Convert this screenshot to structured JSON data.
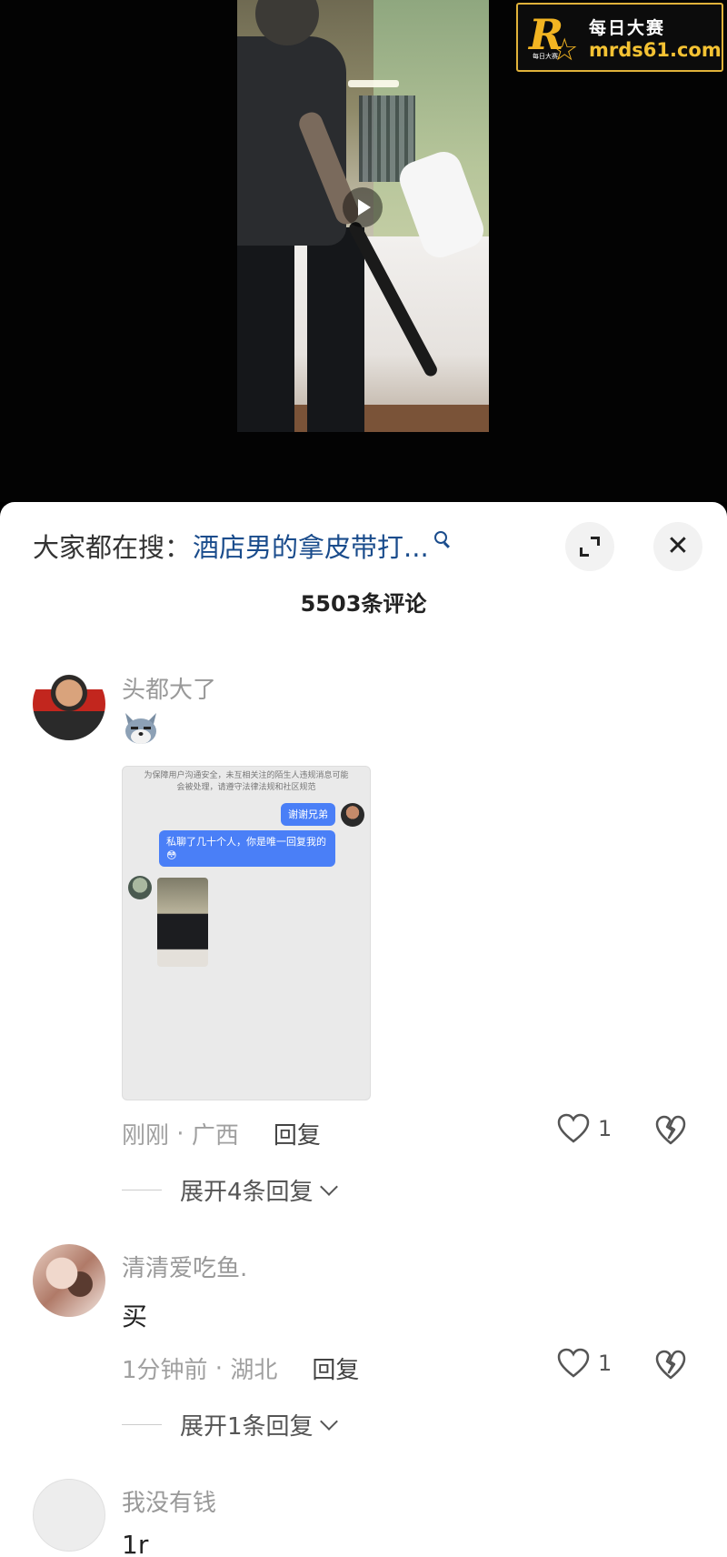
{
  "watermark": {
    "logo_letter": "R",
    "logo_small": "每日大赛",
    "title": "每日大赛",
    "domain": "mrds61.com"
  },
  "panel": {
    "search_prefix": "大家都在搜：",
    "search_query": "酒店男的拿皮带打...",
    "comment_count": "5503条评论",
    "icons": [
      "search-icon",
      "expand-icon",
      "close-icon"
    ]
  },
  "comments": [
    {
      "username": "头都大了",
      "sticker": "wolf-face-emoji",
      "image": {
        "notice": "为保障用户沟通安全，未互相关注的陌生人违规消息可能会被处理，请遵守法律法规和社区规范",
        "bubble_1": "谢谢兄弟",
        "bubble_2": "私聊了几十个人，你是唯一回复我的😳"
      },
      "time": "刚刚",
      "location": "广西",
      "reply": "回复",
      "likes": "1",
      "expand_replies": "展开4条回复"
    },
    {
      "username": "清清爱吃鱼.",
      "text": "买",
      "time": "1分钟前",
      "location": "湖北",
      "reply": "回复",
      "likes": "1",
      "expand_replies": "展开1条回复"
    },
    {
      "username": "我没有钱",
      "text": "1r"
    }
  ],
  "colors": {
    "link_blue": "#1a4c8c",
    "watermark_gold": "#f2b422",
    "chat_bubble": "#4a7ff7"
  }
}
